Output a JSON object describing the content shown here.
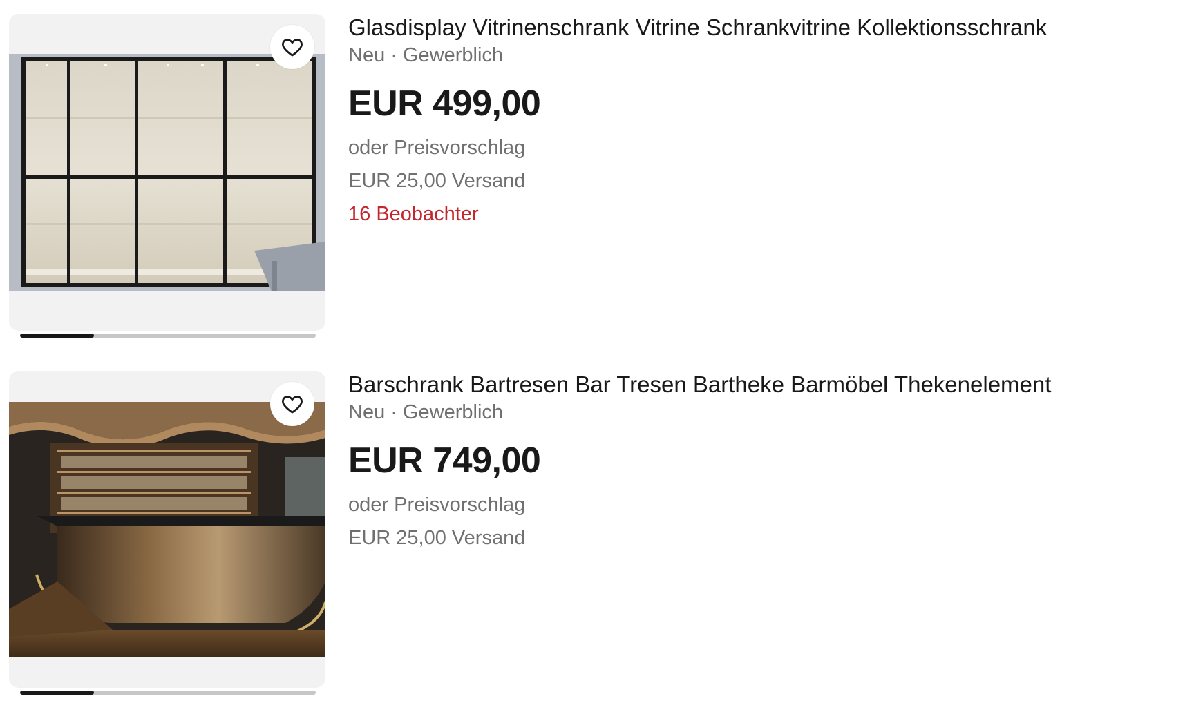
{
  "listings": [
    {
      "title": "Glasdisplay Vitrinenschrank Vitrine Schrankvitrine Kollektionsschrank",
      "subtitle": "Neu · Gewerblich",
      "price": "EUR 499,00",
      "offer": "oder Preisvorschlag",
      "shipping": "EUR 25,00 Versand",
      "watchers": "16 Beobachter",
      "image_progress": 0.25
    },
    {
      "title": "Barschrank Bartresen Bar Tresen Bartheke Barmöbel Thekenelement",
      "subtitle": "Neu · Gewerblich",
      "price": "EUR 749,00",
      "offer": "oder Preisvorschlag",
      "shipping": "EUR 25,00 Versand",
      "image_progress": 0.25
    }
  ],
  "icons": {
    "watch": "heart-icon"
  },
  "colors": {
    "text": "#191919",
    "secondary": "#707070",
    "watchers": "#c1272d",
    "image_bg": "#f2f2f2"
  }
}
